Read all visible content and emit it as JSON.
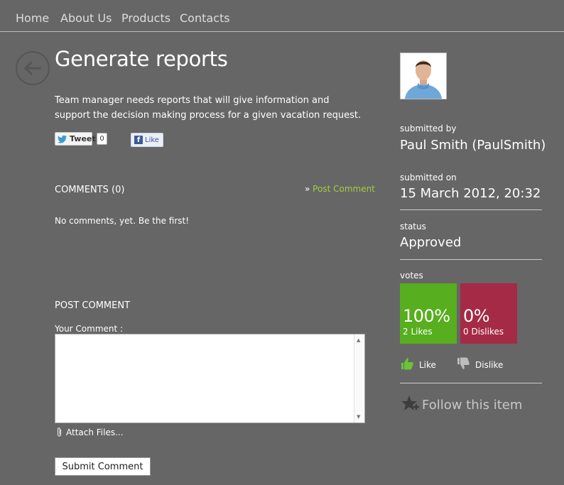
{
  "nav": {
    "items": [
      {
        "label": "Home"
      },
      {
        "label": "About Us"
      },
      {
        "label": "Products"
      },
      {
        "label": "Contacts"
      }
    ]
  },
  "item": {
    "title": "Generate reports",
    "description": "Team manager needs reports that will give information and support the decision making process for a given vacation request."
  },
  "social": {
    "tweet_label": "Tweet",
    "tweet_count": "0",
    "like_label": "Like"
  },
  "comments": {
    "heading": "COMMENTS (0)",
    "post_link_prefix": "»",
    "post_link": "Post Comment",
    "empty_text": "No comments, yet. Be the first!"
  },
  "post_comment": {
    "heading": "POST COMMENT",
    "field_label": "Your Comment :",
    "field_value": "",
    "attach_label": "Attach Files...",
    "submit_label": "Submit Comment"
  },
  "meta": {
    "submitted_by_label": "submitted by",
    "submitted_by_value": "Paul Smith (PaulSmith)",
    "submitted_on_label": "submitted on",
    "submitted_on_value": "15 March 2012, 20:32",
    "status_label": "status",
    "status_value": "Approved"
  },
  "votes": {
    "label": "votes",
    "likes_pct": "100%",
    "likes_count": "2 Likes",
    "dislikes_pct": "0%",
    "dislikes_count": "0 Dislikes",
    "like_action": "Like",
    "dislike_action": "Dislike",
    "like_color": "#57ae1e",
    "dislike_color": "#a52a45"
  },
  "follow": {
    "label": "Follow this item"
  },
  "icons": {
    "back": "arrow-left-circle-icon",
    "tweet": "twitter-bird-icon",
    "facebook": "facebook-f-icon",
    "attach": "paperclip-icon",
    "like": "thumbs-up-icon",
    "dislike": "thumbs-down-icon",
    "follow": "star-plus-icon"
  }
}
